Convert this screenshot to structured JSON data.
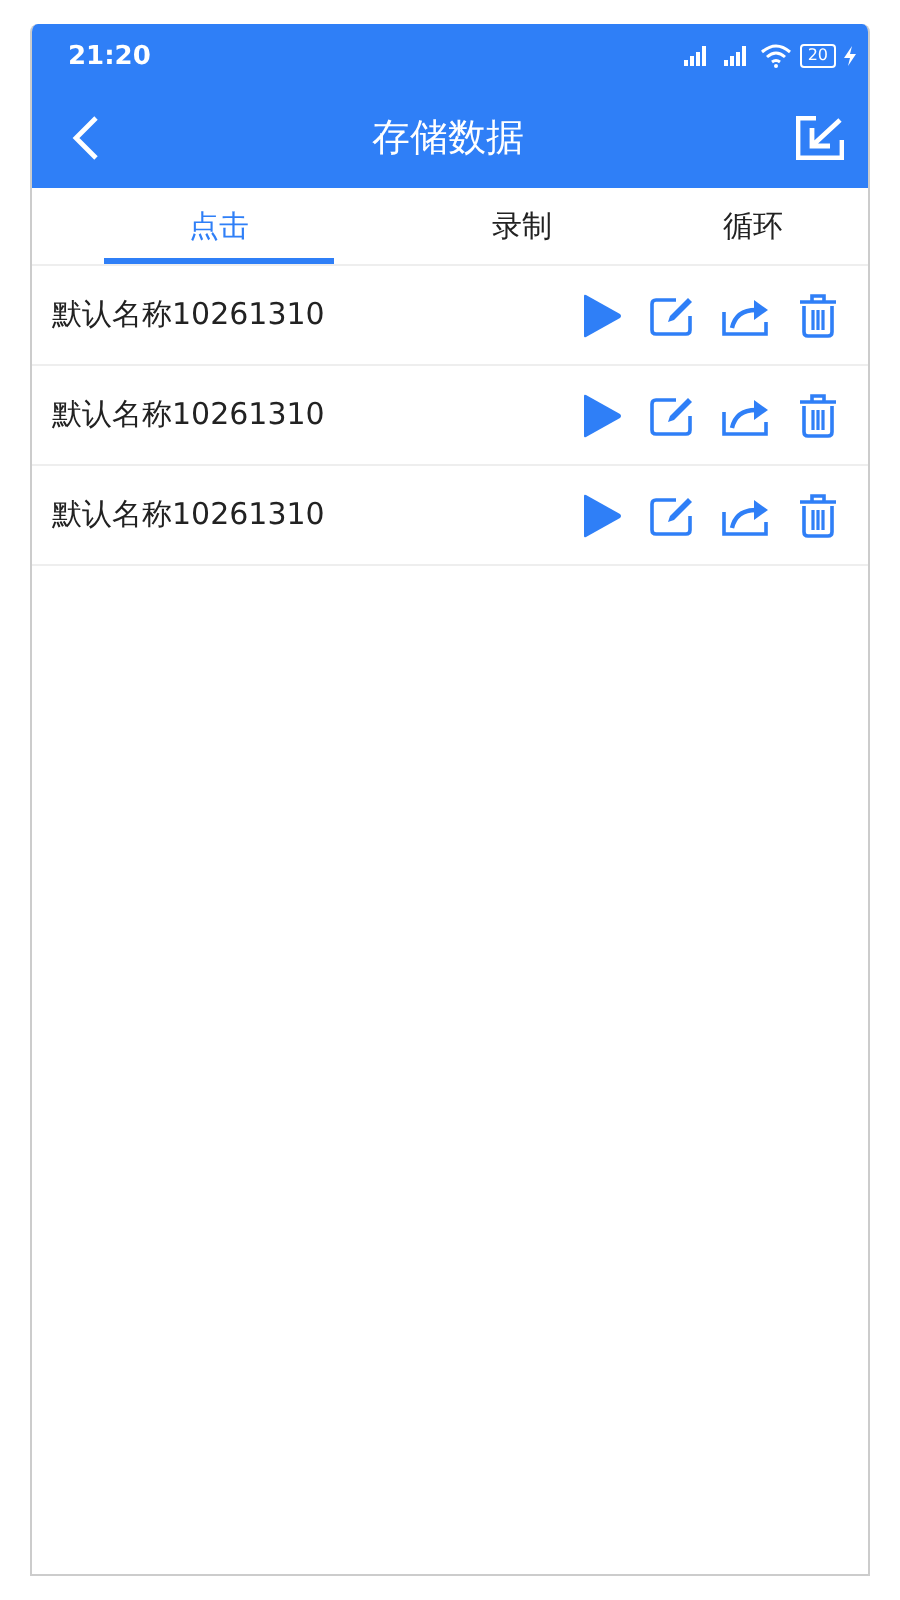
{
  "status_bar": {
    "time": "21:20",
    "battery": "20"
  },
  "header": {
    "title": "存储数据"
  },
  "tabs": [
    {
      "label": "点击",
      "selected": true
    },
    {
      "label": "录制",
      "selected": false
    },
    {
      "label": "循环",
      "selected": false
    }
  ],
  "records": [
    {
      "name": "默认名称10261310"
    },
    {
      "name": "默认名称10261310"
    },
    {
      "name": "默认名称10261310"
    }
  ]
}
